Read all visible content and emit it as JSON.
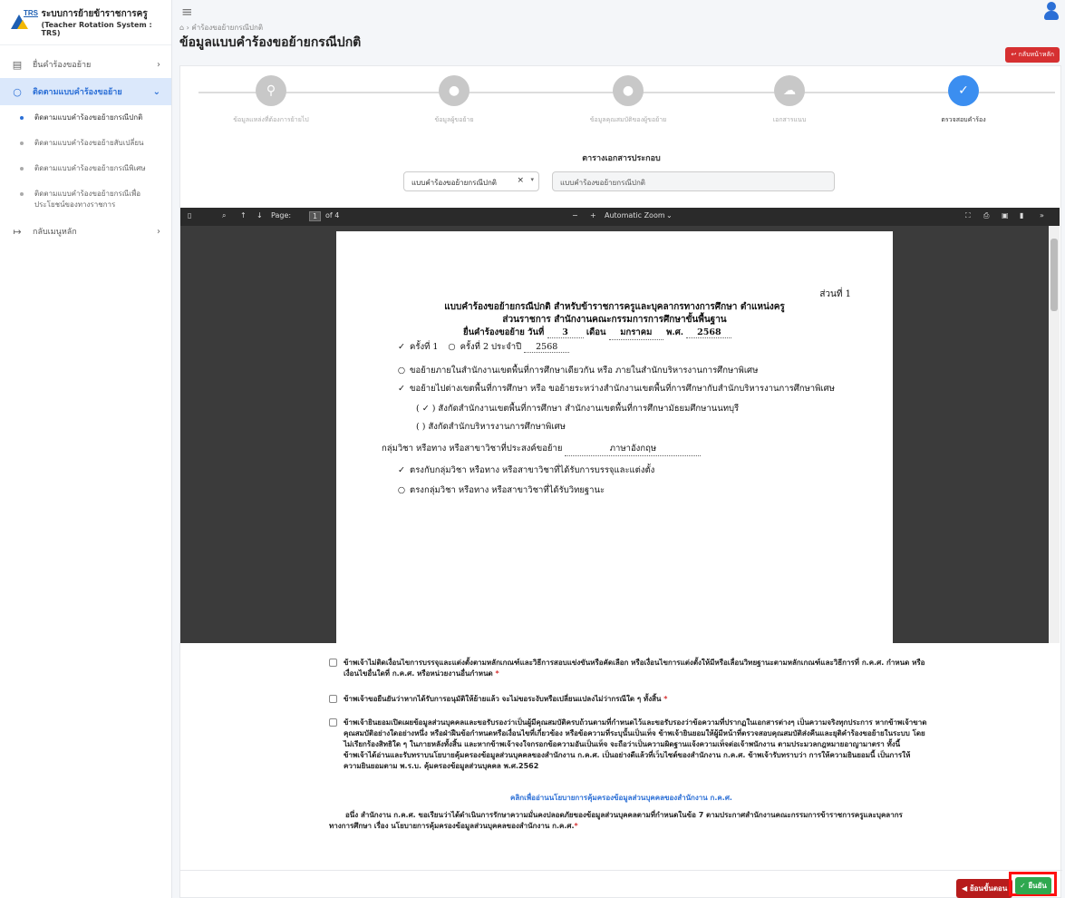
{
  "brand": {
    "title_th": "ระบบการย้ายข้าราชการครู",
    "subtitle_en": "(Teacher Rotation System : TRS)",
    "logo_text": "TRS"
  },
  "sidebar": {
    "items": [
      {
        "label": "ยื่นคำร้องขอย้าย",
        "icon": "file-icon"
      },
      {
        "label": "ติดตามแบบคำร้องขอย้าย",
        "icon": "search-icon"
      },
      {
        "label": "กลับเมนูหลัก",
        "icon": "logout-icon"
      }
    ],
    "subitems": [
      "ติดตามแบบคำร้องขอย้ายกรณีปกติ",
      "ติดตามแบบคำร้องขอย้ายสับเปลี่ยน",
      "ติดตามแบบคำร้องขอย้ายกรณีพิเศษ",
      "ติดตามแบบคำร้องขอย้ายกรณีเพื่อประโยชน์ของทางราชการ"
    ]
  },
  "header": {
    "breadcrumb": "คำร้องขอย้ายกรณีปกติ",
    "title": "ข้อมูลแบบคำร้องขอย้ายกรณีปกติ",
    "back_label": "↩ กลับหน้าหลัก"
  },
  "stepper": {
    "steps": [
      {
        "label": "ข้อมูลแหล่งที่ต้องการย้ายไป",
        "icon": "map-pin-icon",
        "glyph": "⚲"
      },
      {
        "label": "ข้อมูลผู้ขอย้าย",
        "icon": "user-icon",
        "glyph": "●"
      },
      {
        "label": "ข้อมูลคุณสมบัติของผู้ขอย้าย",
        "icon": "users-icon",
        "glyph": "●"
      },
      {
        "label": "เอกสารแนบ",
        "icon": "cloud-icon",
        "glyph": "☁"
      },
      {
        "label": "ตรวจสอบคำร้อง",
        "icon": "check-icon",
        "glyph": "✓"
      }
    ]
  },
  "documents": {
    "title": "ตารางเอกสารประกอบ",
    "selected": "แบบคำร้องขอย้ายกรณีปกติ",
    "name": "แบบคำร้องขอย้ายกรณีปกติ"
  },
  "viewer": {
    "page_label": "Page:",
    "page_value": "1",
    "page_total": "of 4",
    "zoom": "Automatic Zoom"
  },
  "pdf": {
    "part": "ส่วนที่ 1",
    "head1": "แบบคำร้องขอย้ายกรณีปกติ สำหรับข้าราชการครูและบุคลากรทางการศึกษา ตำแหน่งครู",
    "head2": "ส่วนราชการ สำนักงานคณะกรรมการการศึกษาขั้นพื้นฐาน",
    "date_prefix": "ยื่นคำร้องขอย้าย วันที่",
    "day": "3",
    "month_label": "เดือน",
    "month": "มกราคม",
    "year_label": "พ.ศ.",
    "year": "2568",
    "round1": "ครั้งที่ 1",
    "round2": "ครั้งที่ 2 ประจำปี",
    "round_year": "2568",
    "opt1": "ขอย้ายภายในสำนักงานเขตพื้นที่การศึกษาเดียวกัน หรือ ภายในสำนักบริหารงานการศึกษาพิเศษ",
    "opt2": "ขอย้ายไปต่างเขตพื้นที่การศึกษา หรือ ขอย้ายระหว่างสำนักงานเขตพื้นที่การศึกษากับสำนักบริหารงานการศึกษาพิเศษ",
    "opt2a": "( ✓ ) สังกัดสำนักงานเขตพื้นที่การศึกษา สำนักงานเขตพื้นที่การศึกษามัธยมศึกษานนทบุรี",
    "opt2b": "(    ) สังกัดสำนักบริหารงานการศึกษาพิเศษ",
    "subject_label": "กลุ่มวิชา หรือทาง หรือสาขาวิชาที่ประสงค์ขอย้าย",
    "subject": "ภาษาอังกฤษ",
    "match1": "ตรงกับกลุ่มวิชา หรือทาง หรือสาขาวิชาที่ได้รับการบรรจุและแต่งตั้ง",
    "match2": "ตรงกลุ่มวิชา หรือทาง หรือสาขาวิชาที่ได้รับวิทยฐานะ"
  },
  "consent": {
    "c1": "ข้าพเจ้าไม่ติดเงื่อนไขการบรรจุและแต่งตั้งตามหลักเกณฑ์และวิธีการสอบแข่งขันหรือคัดเลือก หรือเงื่อนไขการแต่งตั้งให้มีหรือเลื่อนวิทยฐานะตามหลักเกณฑ์และวิธีการที่ ก.ค.ศ. กำหนด หรือเงื่อนไขอื่นใดที่ ก.ค.ศ. หรือหน่วยงานอื่นกำหนด",
    "c2": "ข้าพเจ้าขอยืนยันว่าหากได้รับการอนุมัติให้ย้ายแล้ว จะไม่ขอระงับหรือเปลี่ยนแปลงไม่ว่ากรณีใด ๆ ทั้งสิ้น",
    "c3": "ข้าพเจ้ายินยอมเปิดเผยข้อมูลส่วนบุคคลและขอรับรองว่าเป็นผู้มีคุณสมบัติครบถ้วนตามที่กำหนดไว้และขอรับรองว่าข้อความที่ปรากฏในเอกสารต่างๆ เป็นความจริงทุกประการ หากข้าพเจ้าขาดคุณสมบัติอย่างใดอย่างหนึ่ง หรือฝ่าฝืนข้อกำหนดหรือเงื่อนไขที่เกี่ยวข้อง หรือข้อความที่ระบุนั้นเป็นเท็จ ข้าพเจ้ายินยอมให้ผู้มีหน้าที่ตรวจสอบคุณสมบัติส่งคืนและยุติคำร้องขอย้ายในระบบ โดยไม่เรียกร้องสิทธิใด ๆ ในภายหลังทั้งสิ้น และหากข้าพเจ้าจงใจกรอกข้อความอันเป็นเท็จ จะถือว่าเป็นความผิดฐานแจ้งความเท็จต่อเจ้าพนักงาน ตามประมวลกฎหมายอาญามาตรา ทั้งนี้ ข้าพเจ้าได้อ่านและรับทราบนโยบายคุ้มครองข้อมูลส่วนบุคคลของสำนักงาน ก.ค.ศ. เป็นอย่างดีแล้วที่เว็บไซต์ของสำนักงาน ก.ค.ศ. ข้าพเจ้ารับทราบว่า การให้ความยินยอมนี้ เป็นการให้ความยินยอมตาม พ.ร.บ. คุ้มครองข้อมูลส่วนบุคคล พ.ศ.2562",
    "required": "*",
    "policy_link": "คลิกเพื่ออ่านนโยบายการคุ้มครองข้อมูลส่วนบุคคลของสำนักงาน ก.ค.ศ.",
    "policy_note": "อนึ่ง สำนักงาน ก.ค.ศ. ขอเรียนว่าได้ดำเนินการรักษาความมั่นคงปลอดภัยของข้อมูลส่วนบุคคลตามที่กำหนดในข้อ 7 ตามประกาศสำนักงานคณะกรรมการข้าราชการครูและบุคลากรทางการศึกษา เรื่อง นโยบายการคุ้มครองข้อมูลส่วนบุคคลของสำนักงาน ก.ค.ศ."
  },
  "footer": {
    "prev_label": "◀ ย้อนขั้นตอน",
    "confirm_label": "✓ ยืนยัน"
  },
  "colors": {
    "primary": "#2b6fd6",
    "danger": "#d63031",
    "success": "#2fa84f",
    "highlight": "#ff1010"
  }
}
